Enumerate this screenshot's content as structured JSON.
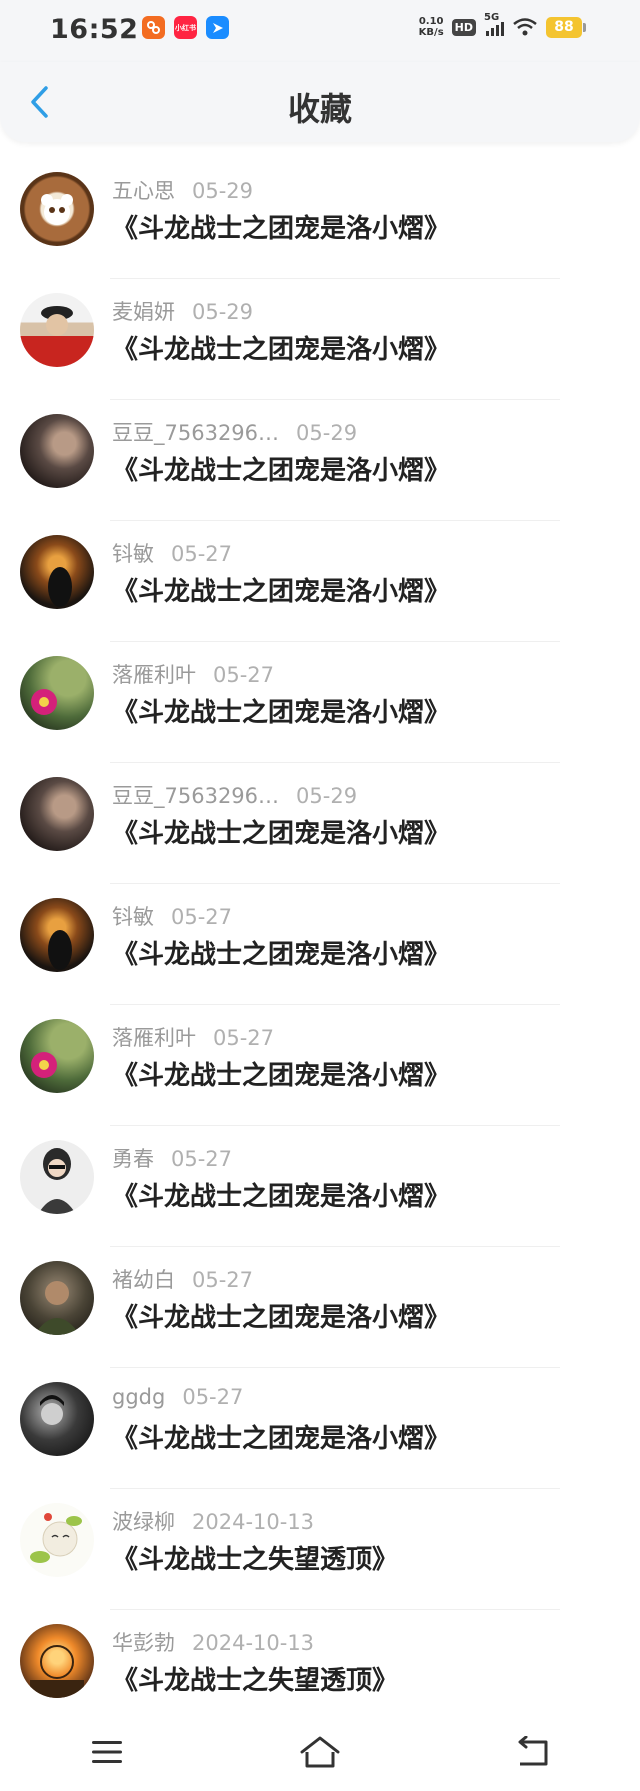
{
  "status_bar": {
    "time": "16:52",
    "net_speed_value": "0.10",
    "net_speed_unit": "KB/s",
    "hd": "HD",
    "network": "5G",
    "battery": "88",
    "app_icons": [
      "app-icon-1",
      "xiaohongshu-icon",
      "app-icon-3"
    ],
    "xiaohongshu_label": "小红书"
  },
  "header": {
    "title": "收藏"
  },
  "items": [
    {
      "user": "五心思",
      "date": "05-29",
      "title": "《斗龙战士之团宠是洛小熠》"
    },
    {
      "user": "麦娟妍",
      "date": "05-29",
      "title": "《斗龙战士之团宠是洛小熠》"
    },
    {
      "user": "豆豆_7563296…",
      "date": "05-29",
      "title": "《斗龙战士之团宠是洛小熠》"
    },
    {
      "user": "钭敏",
      "date": "05-27",
      "title": "《斗龙战士之团宠是洛小熠》"
    },
    {
      "user": "落雁利叶",
      "date": "05-27",
      "title": "《斗龙战士之团宠是洛小熠》"
    },
    {
      "user": "豆豆_7563296…",
      "date": "05-29",
      "title": "《斗龙战士之团宠是洛小熠》"
    },
    {
      "user": "钭敏",
      "date": "05-27",
      "title": "《斗龙战士之团宠是洛小熠》"
    },
    {
      "user": "落雁利叶",
      "date": "05-27",
      "title": "《斗龙战士之团宠是洛小熠》"
    },
    {
      "user": "勇春",
      "date": "05-27",
      "title": "《斗龙战士之团宠是洛小熠》"
    },
    {
      "user": "褚幼白",
      "date": "05-27",
      "title": "《斗龙战士之团宠是洛小熠》"
    },
    {
      "user": "ggdg",
      "date": "05-27",
      "title": "《斗龙战士之团宠是洛小熠》"
    },
    {
      "user": "波绿柳",
      "date": "2024-10-13",
      "title": "《斗龙战士之失望透顶》"
    },
    {
      "user": "华彭勃",
      "date": "2024-10-13",
      "title": "《斗龙战士之失望透顶》"
    }
  ],
  "bottom_nav": [
    "menu-icon",
    "home-icon",
    "back-icon"
  ],
  "colors": {
    "accent": "#2f9ee6",
    "title_text": "#222222",
    "meta_text": "#9a9a9a",
    "battery": "#f4c430"
  }
}
